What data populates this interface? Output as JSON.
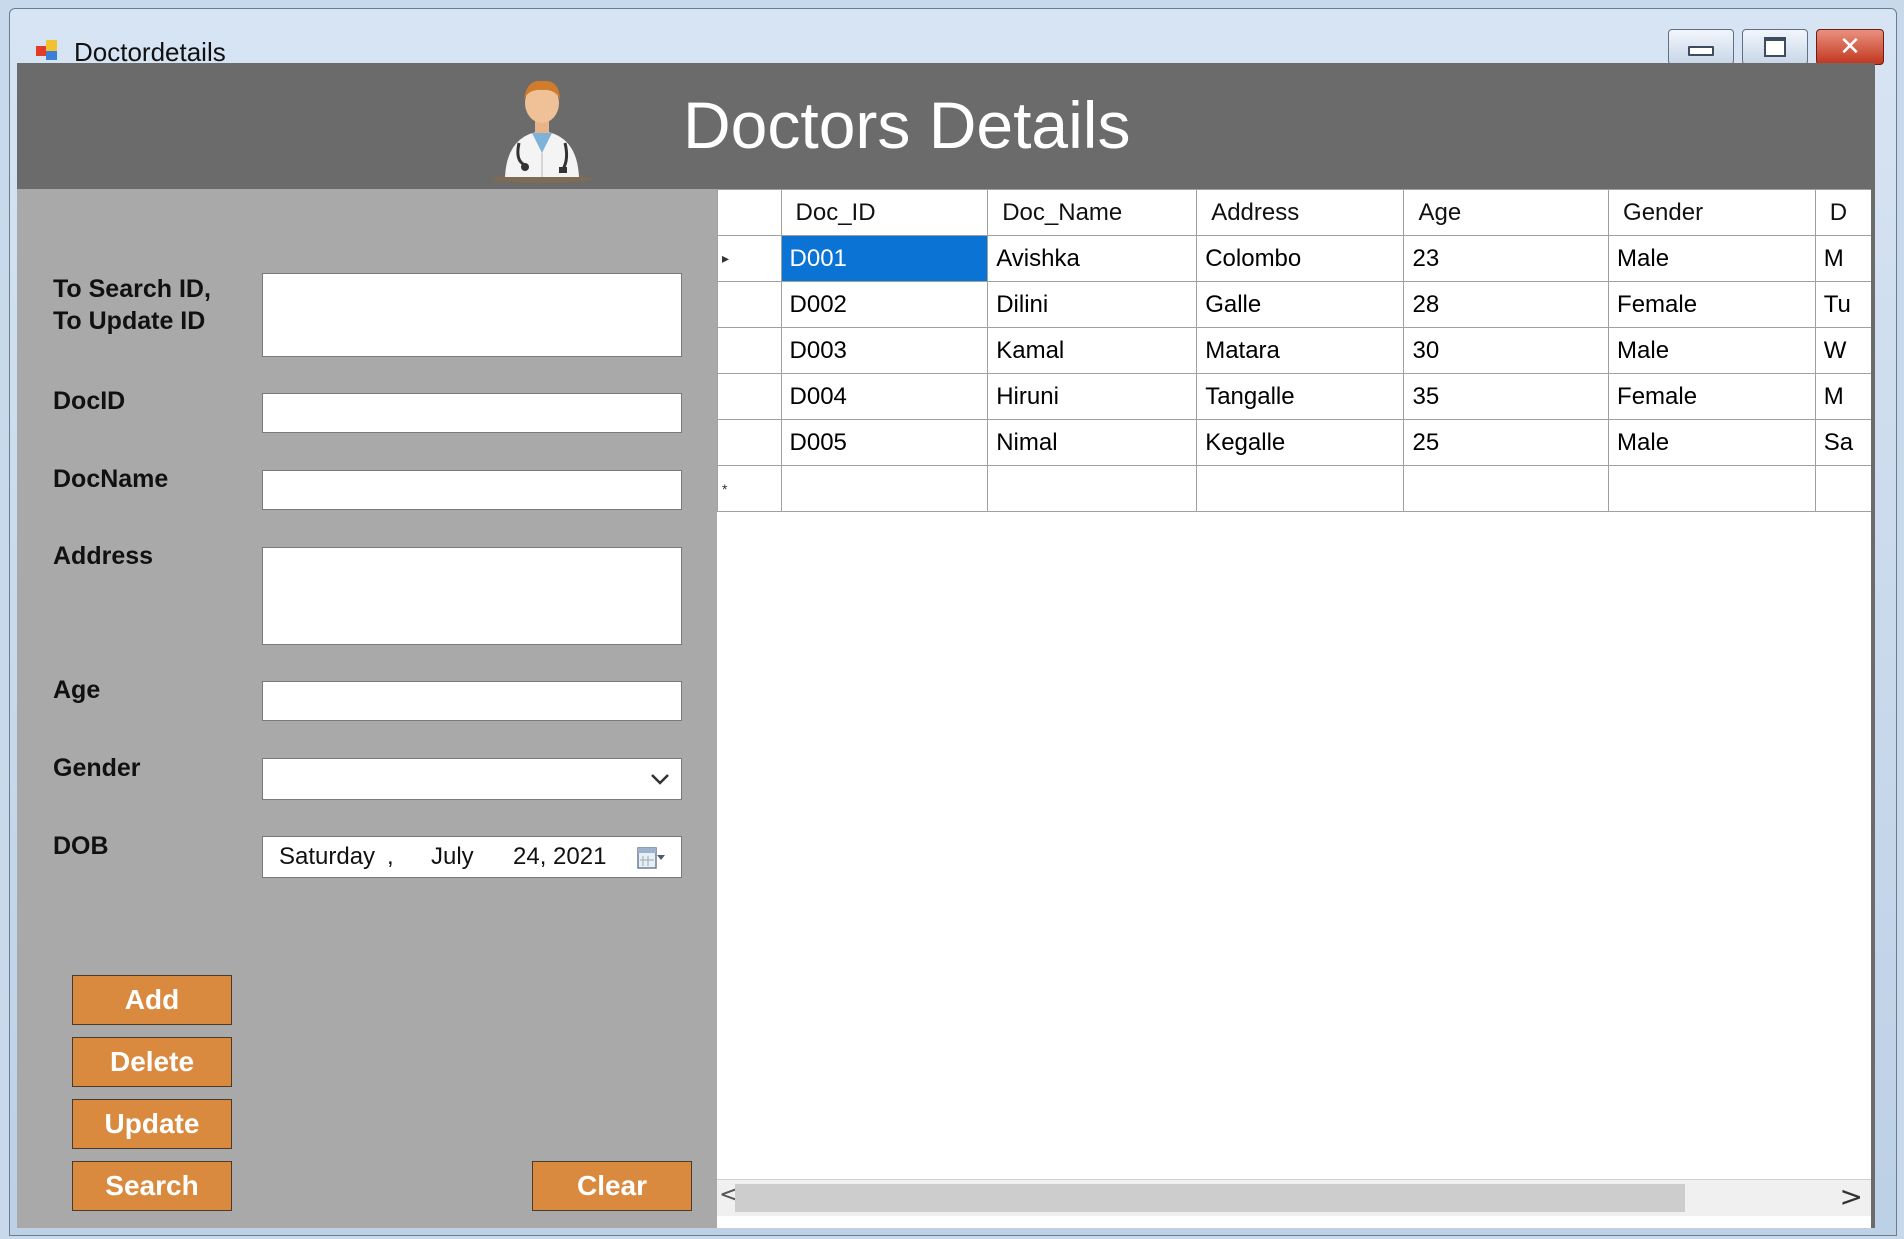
{
  "window": {
    "title": "Doctordetails",
    "controls": {
      "minimize": "minimize",
      "maximize": "maximize",
      "close": "✕"
    }
  },
  "header": {
    "title": "Doctors Details",
    "icon": "doctor-icon"
  },
  "form": {
    "search_label_line1": "To Search ID,",
    "search_label_line2": "To Update ID",
    "search_value": "",
    "docid_label": "DocID",
    "docid_value": "",
    "docname_label": "DocName",
    "docname_value": "",
    "address_label": "Address",
    "address_value": "",
    "age_label": "Age",
    "age_value": "",
    "gender_label": "Gender",
    "gender_value": "",
    "dob_label": "DOB",
    "dob": {
      "weekday": "Saturday",
      "sep": ",",
      "month": "July",
      "day_year": "24, 2021"
    }
  },
  "buttons": {
    "add": "Add",
    "delete": "Delete",
    "update": "Update",
    "search": "Search",
    "clear": "Clear"
  },
  "colors": {
    "header_bg": "#6b6b6b",
    "panel_bg": "#a9a9a9",
    "button_bg": "#d98a3f",
    "selection": "#0a73d4"
  },
  "table": {
    "columns": [
      "Doc_ID",
      "Doc_Name",
      "Address",
      "Age",
      "Gender",
      "D"
    ],
    "rows": [
      [
        "D001",
        "Avishka",
        "Colombo",
        "23",
        "Male",
        "M"
      ],
      [
        "D002",
        "Dilini",
        "Galle",
        "28",
        "Female",
        "Tu"
      ],
      [
        "D003",
        "Kamal",
        "Matara",
        "30",
        "Male",
        "W"
      ],
      [
        "D004",
        "Hiruni",
        "Tangalle",
        "35",
        "Female",
        "M"
      ],
      [
        "D005",
        "Nimal",
        "Kegalle",
        "25",
        "Male",
        "Sa"
      ]
    ],
    "current_row_marker": "▸",
    "new_row_marker": "*"
  },
  "scrollbar": {
    "left_arrow": "<",
    "right_arrow": ">"
  }
}
